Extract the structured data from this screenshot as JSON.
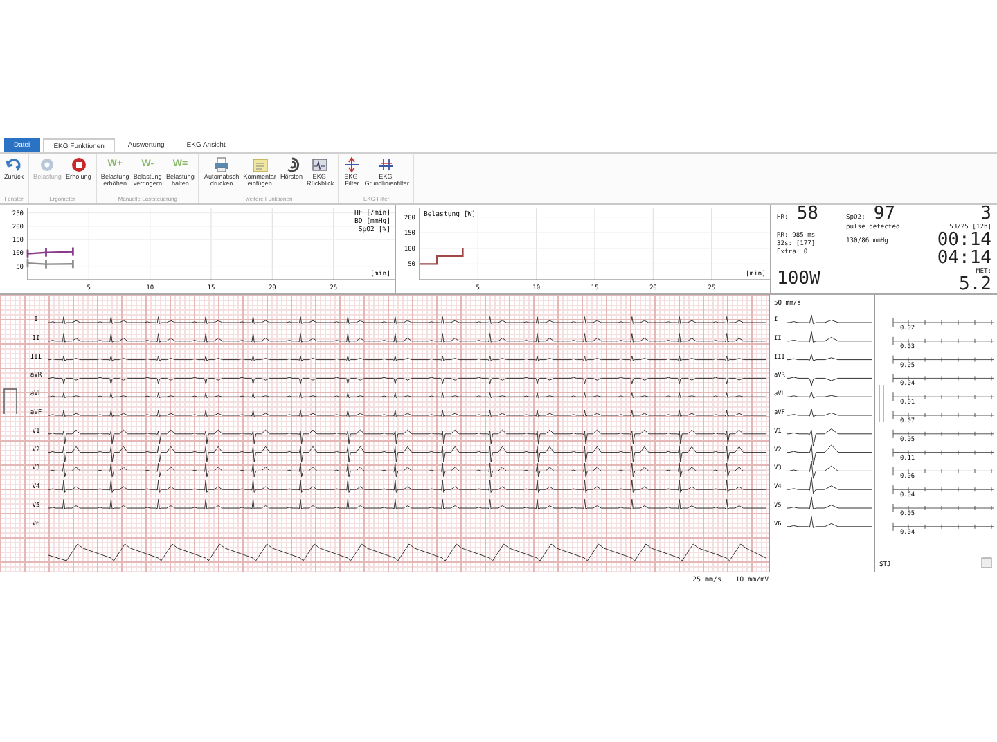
{
  "ribbon": {
    "tabs": [
      {
        "label": "Datei",
        "kind": "file",
        "selected": false
      },
      {
        "label": "EKG Funktionen",
        "kind": "tab",
        "selected": true
      },
      {
        "label": "Auswertung",
        "kind": "tab",
        "selected": false
      },
      {
        "label": "EKG Ansicht",
        "kind": "tab",
        "selected": false
      }
    ],
    "groups": [
      {
        "label": "Fenster",
        "buttons": [
          {
            "kind": "back",
            "label": "Zurück",
            "disabled": false
          }
        ]
      },
      {
        "label": "Ergometer",
        "buttons": [
          {
            "kind": "gear",
            "label": "Belastung",
            "disabled": true
          },
          {
            "kind": "stop",
            "label": "Erholung",
            "disabled": false
          }
        ]
      },
      {
        "label": "Manuelle Laststeuerung",
        "buttons": [
          {
            "kind": "text",
            "icon_text": "W+",
            "label": "Belastung erhöhen",
            "disabled": false
          },
          {
            "kind": "text",
            "icon_text": "W-",
            "label": "Belastung verringern",
            "disabled": false
          },
          {
            "kind": "text",
            "icon_text": "W=",
            "label": "Belastung halten",
            "disabled": false
          }
        ]
      },
      {
        "label": "weitere Funktionen",
        "buttons": [
          {
            "kind": "printer",
            "label": "Automatisch drucken",
            "disabled": false
          },
          {
            "kind": "note",
            "label": "Kommentar einfügen",
            "disabled": false
          },
          {
            "kind": "ear",
            "label": "Hörston",
            "disabled": false
          },
          {
            "kind": "monitor",
            "label": "EKG-Rückblick",
            "disabled": false
          }
        ]
      },
      {
        "label": "EKG-Filter",
        "buttons": [
          {
            "kind": "filter",
            "label": "EKG-Filter",
            "disabled": false
          },
          {
            "kind": "baseline",
            "label": "EKG-Grundlinienfilter",
            "disabled": false
          }
        ]
      }
    ]
  },
  "trend_charts": [
    {
      "axis_labels": [
        "HF [/min]",
        "BD [mmHg]",
        "SpO2 [%]"
      ],
      "chart_data": {
        "type": "line",
        "xlabel": "[min]",
        "x": [
          0,
          1.5,
          3.7
        ],
        "xlim": [
          0,
          30
        ],
        "ylim": [
          0,
          270
        ],
        "xticks": [
          5,
          10,
          15,
          20,
          25
        ],
        "yticks": [
          50,
          100,
          150,
          200,
          250
        ],
        "series": [
          {
            "color": "#8c8c8c",
            "values": [
              62,
              58,
              59
            ]
          },
          {
            "color": "#8a3a8a",
            "values": [
              97,
              102,
              105
            ]
          }
        ],
        "grid": true
      }
    },
    {
      "chart_data": {
        "type": "line",
        "xlabel": "[min]",
        "grid": true,
        "x": [
          0,
          1.5,
          1.5,
          3.7,
          3.7
        ],
        "xlim": [
          0,
          30
        ],
        "ylim": [
          0,
          230
        ],
        "xticks": [
          5,
          10,
          15,
          20,
          25
        ],
        "yticks": [
          50,
          100,
          150,
          200
        ],
        "series": [
          {
            "name": "Belastung [W]",
            "color": "#a04848",
            "values": [
              50,
              50,
              75,
              75,
              100
            ]
          }
        ]
      }
    }
  ],
  "vitals": {
    "hr_label": "HR:",
    "hr": "58",
    "spo2_label": "SpO2:",
    "spo2": "97",
    "count": "3",
    "pulse_status": "pulse detected",
    "st_count": "53/25 [12h]",
    "rr": "RR: 985 ms",
    "rr_count": "32s: [177]",
    "extra": "Extra: 0",
    "bp": "130/86 mmHg",
    "time_1": "00:14",
    "time_2": "04:14",
    "met_label": "MET:",
    "met": "5.2",
    "load": "100W"
  },
  "main_leads": [
    {
      "label": "I",
      "signal": true
    },
    {
      "label": "II",
      "signal": true
    },
    {
      "label": "III",
      "signal": true
    },
    {
      "label": "aVR",
      "signal": true
    },
    {
      "label": "aVL",
      "signal": true
    },
    {
      "label": "aVF",
      "signal": true
    },
    {
      "label": "V1",
      "signal": true
    },
    {
      "label": "V2",
      "signal": true
    },
    {
      "label": "V3",
      "signal": true
    },
    {
      "label": "V4",
      "signal": true
    },
    {
      "label": "V5",
      "signal": true
    },
    {
      "label": "V6",
      "signal": false
    }
  ],
  "detail": {
    "speed": "50 mm/s",
    "leads": [
      "I",
      "II",
      "III",
      "aVR",
      "aVL",
      "aVF",
      "V1",
      "V2",
      "V3",
      "V4",
      "V5",
      "V6"
    ]
  },
  "st": {
    "values": [
      "0.02",
      "0.03",
      "0.05",
      "0.04",
      "0.01",
      "0.07",
      "0.05",
      "0.11",
      "0.06",
      "0.04",
      "0.05",
      "0.04"
    ],
    "label": "STJ"
  },
  "footer": {
    "speed": "25 mm/s",
    "gain": "10 mm/mV"
  }
}
